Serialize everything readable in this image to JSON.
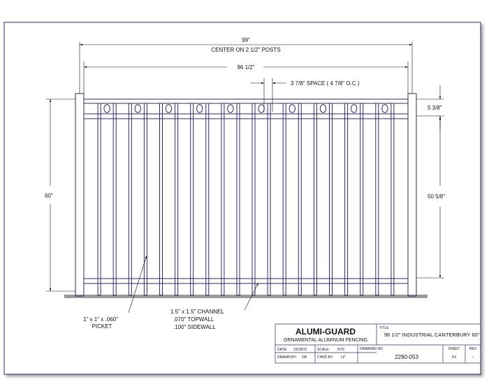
{
  "dimensions": {
    "overall_width": "99\"",
    "post_centers": "CENTER ON 2 1/2\" POSTS",
    "panel_width": "96 1/2\"",
    "picket_space": "3 7/8\" SPACE ( 4 7/8\" O.C )",
    "top_rail_drop": "5 3/8\"",
    "overall_height": "60\"",
    "picket_height": "50 5/8\""
  },
  "callouts": {
    "picket_line1": "1\" x 1\" x .060\"",
    "picket_line2": "PICKET",
    "channel_line1": "1.5\" x 1.5\" CHANNEL",
    "channel_line2": ".070\" TOPWALL",
    "channel_line3": ".100\" SIDEWALL"
  },
  "title_block": {
    "company": "ALUMI-GUARD",
    "tagline": "ORNAMENTAL ALUMINUM FENCING",
    "title_label": "TITLE",
    "title": "96 1/2\" INDUSTRIAL CANTERBURY 60\"",
    "date_label": "DATE:",
    "date": "10/18/12",
    "scale_label": "SCALE:",
    "scale": "NTS",
    "drawn_label": "DRAWN BY:",
    "drawn": "DR",
    "checked_label": "CHKD BY:",
    "checked": "LP",
    "drawing_no_label": "DRAWING NO",
    "drawing_no": "2290-053",
    "sheet_label": "SHEET",
    "sheet": "XX",
    "rev_label": "REV",
    "rev": "--"
  }
}
